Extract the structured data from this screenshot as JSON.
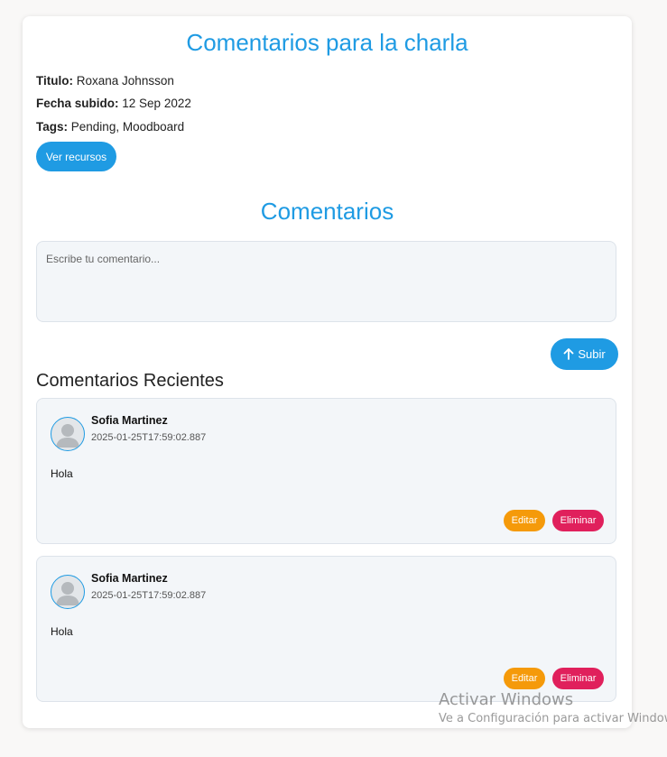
{
  "page": {
    "title": "Comentarios para la charla",
    "meta": {
      "title_label": "Titulo:",
      "title_value": "Roxana Johnsson",
      "date_label": "Fecha subido:",
      "date_value": "12 Sep 2022",
      "tags_label": "Tags:",
      "tags_value": "Pending, Moodboard"
    },
    "resources_button": "Ver recursos",
    "comments_section_title": "Comentarios",
    "comment_input": {
      "placeholder": "Escribe tu comentario...",
      "value": ""
    },
    "submit_button": "Subir",
    "recent_title": "Comentarios Recientes"
  },
  "comments": [
    {
      "author": "Sofia Martinez",
      "timestamp": "2025-01-25T17:59:02.887",
      "text": "Hola",
      "edit_label": "Editar",
      "delete_label": "Eliminar"
    },
    {
      "author": "Sofia Martinez",
      "timestamp": "2025-01-25T17:59:02.887",
      "text": "Hola",
      "edit_label": "Editar",
      "delete_label": "Eliminar"
    }
  ],
  "watermark": {
    "title": "Activar Windows",
    "subtitle": "Ve a Configuración para activar Windows."
  },
  "colors": {
    "accent": "#1f9be3",
    "edit": "#f59a0a",
    "delete": "#e0205c",
    "card_bg": "#f3f6f9"
  }
}
